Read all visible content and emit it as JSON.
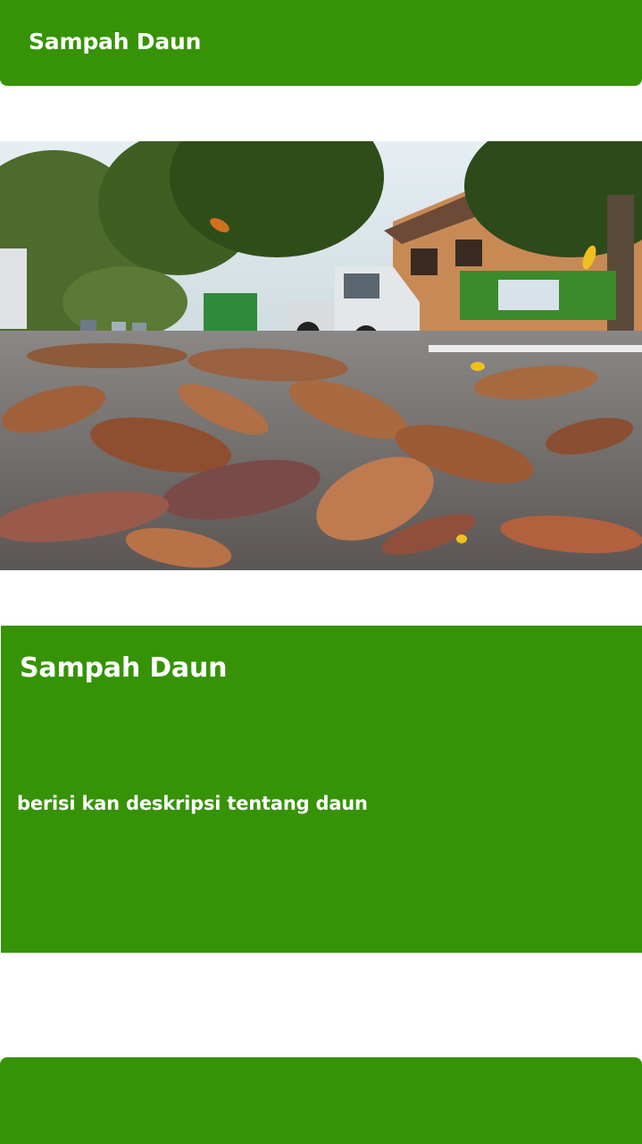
{
  "app_bar": {
    "title": "Sampah Daun"
  },
  "hero_image": {
    "alt_subject": "dry-leaves-on-street-photo"
  },
  "card": {
    "title": "Sampah Daun",
    "description": "berisi kan deskripsi tentang daun"
  },
  "colors": {
    "primary_green": "#359305",
    "text_on_primary": "#ffffff",
    "background": "#ffffff"
  }
}
